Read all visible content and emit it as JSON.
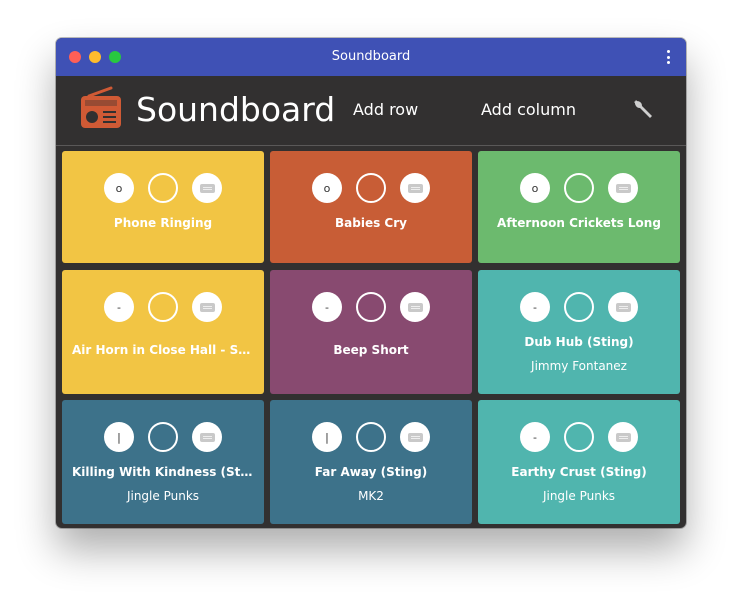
{
  "window": {
    "title": "Soundboard"
  },
  "header": {
    "app_name": "Soundboard",
    "add_row_label": "Add row",
    "add_column_label": "Add column"
  },
  "colors": {
    "titlebar": "#3f51b5",
    "header_bg": "#323030",
    "yellow": "#f2c544",
    "orange": "#c85d36",
    "green": "#6cba6e",
    "purple": "#884a70",
    "teal": "#50b5ae",
    "steel_blue": "#3d728a",
    "logo": "#d05a35"
  },
  "sounds": [
    {
      "title": "Phone Ringing",
      "subtitle": "",
      "play_symbol": "o",
      "color": "#f2c544"
    },
    {
      "title": "Babies Cry",
      "subtitle": "",
      "play_symbol": "o",
      "color": "#c85d36"
    },
    {
      "title": "Afternoon Crickets Long",
      "subtitle": "",
      "play_symbol": "o",
      "color": "#6cba6e"
    },
    {
      "title": "Air Horn in Close Hall - Se...",
      "subtitle": "",
      "play_symbol": "-",
      "color": "#f2c544"
    },
    {
      "title": "Beep Short",
      "subtitle": "",
      "play_symbol": "-",
      "color": "#884a70"
    },
    {
      "title": "Dub Hub (Sting)",
      "subtitle": "Jimmy Fontanez",
      "play_symbol": "-",
      "color": "#50b5ae"
    },
    {
      "title": "Killing With Kindness (Sti...",
      "subtitle": "Jingle Punks",
      "play_symbol": "|",
      "color": "#3d728a"
    },
    {
      "title": "Far Away (Sting)",
      "subtitle": "MK2",
      "play_symbol": "|",
      "color": "#3d728a"
    },
    {
      "title": "Earthy Crust (Sting)",
      "subtitle": "Jingle Punks",
      "play_symbol": "-",
      "color": "#50b5ae"
    }
  ],
  "icons": {
    "logo": "radio-icon",
    "settings": "wrench-icon",
    "menu": "kebab-menu-icon",
    "shortcut": "keyboard-icon"
  }
}
